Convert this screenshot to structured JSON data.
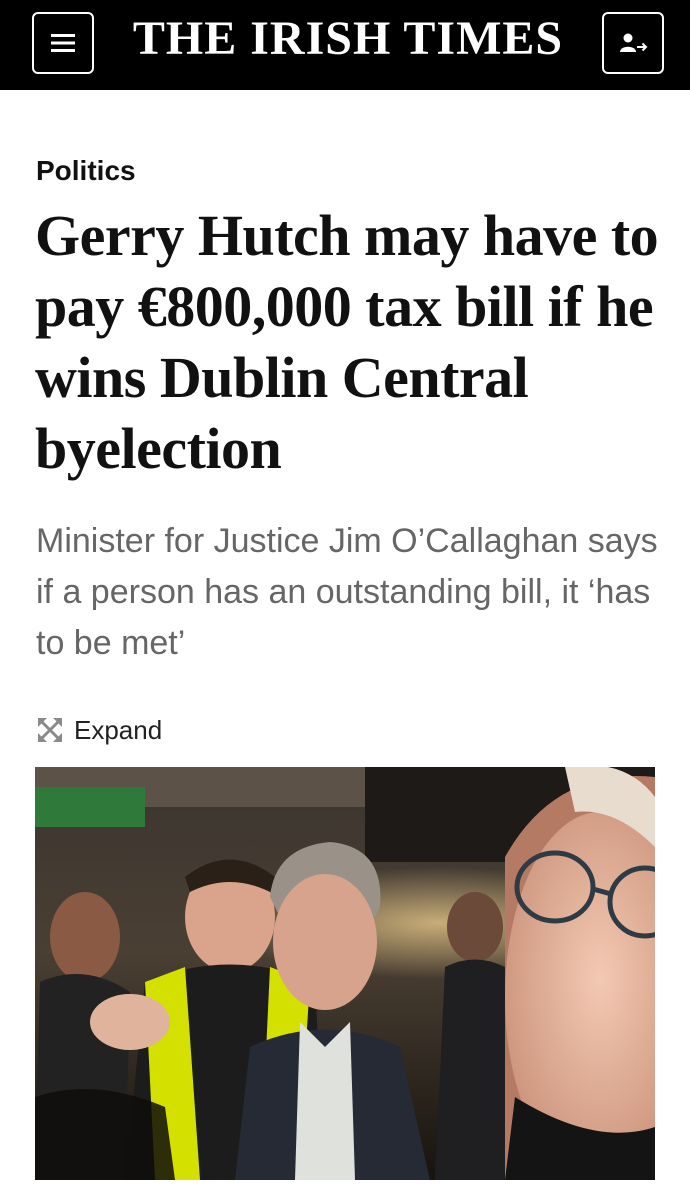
{
  "masthead": {
    "title": "THE IRISH TIMES",
    "menu_icon": "hamburger-menu-icon",
    "account_icon": "account-sign-in-icon",
    "background": "#000000",
    "text_color": "#ffffff"
  },
  "article": {
    "section": "Politics",
    "headline": "Gerry Hutch may have to pay €800,000 tax bill if he wins Dublin Central byelection",
    "standfirst": "Minister for Justice Jim O’Callaghan says if a person has an outstanding bill, it ‘has to be met’",
    "standfirst_color": "#666666"
  },
  "media": {
    "expand_label": "Expand",
    "expand_icon": "expand-arrows-icon"
  }
}
